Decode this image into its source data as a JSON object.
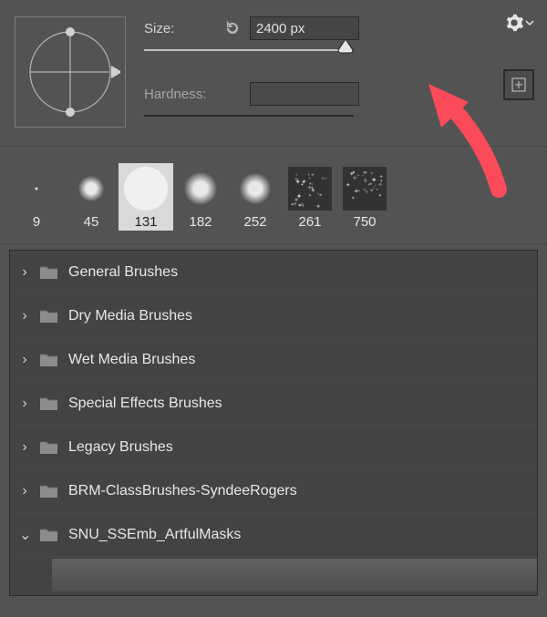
{
  "brush": {
    "size_label": "Size:",
    "size_value": "2400 px",
    "hardness_label": "Hardness:",
    "hardness_value": ""
  },
  "thumbnails": [
    {
      "size": "9"
    },
    {
      "size": "45"
    },
    {
      "size": "131",
      "selected": true
    },
    {
      "size": "182"
    },
    {
      "size": "252"
    },
    {
      "size": "261",
      "tex": true
    },
    {
      "size": "750",
      "tex": true
    }
  ],
  "folders": [
    {
      "name": "General Brushes",
      "open": false
    },
    {
      "name": "Dry Media Brushes",
      "open": false
    },
    {
      "name": "Wet Media Brushes",
      "open": false
    },
    {
      "name": "Special Effects Brushes",
      "open": false
    },
    {
      "name": "Legacy Brushes",
      "open": false
    },
    {
      "name": "BRM-ClassBrushes-SyndeeRogers",
      "open": false
    },
    {
      "name": "SNU_SSEmb_ArtfulMasks",
      "open": true
    }
  ]
}
